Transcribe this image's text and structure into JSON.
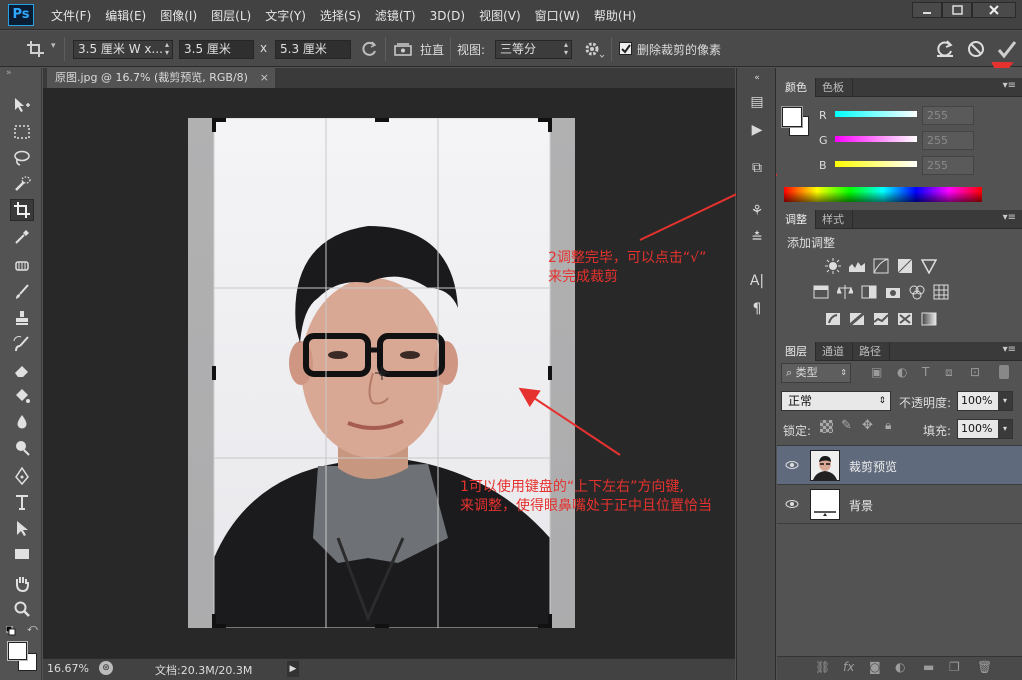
{
  "app": {
    "logo": "Ps"
  },
  "menu": [
    "文件(F)",
    "编辑(E)",
    "图像(I)",
    "图层(L)",
    "文字(Y)",
    "选择(S)",
    "滤镜(T)",
    "3D(D)",
    "视图(V)",
    "窗口(W)",
    "帮助(H)"
  ],
  "options": {
    "ratio_preset": "3.5 厘米 W x...",
    "width": "3.5 厘米",
    "times": "x",
    "height": "5.3 厘米",
    "straighten_label": "拉直",
    "view_label": "视图:",
    "view_value": "三等分",
    "delete_cropped_label": "删除裁剪的像素",
    "delete_cropped_checked": true
  },
  "document": {
    "tab_title": "原图.jpg @ 16.7% (裁剪预览, RGB/8)",
    "close_glyph": "×",
    "zoom": "16.67%",
    "doc_size": "文档:20.3M/20.3M"
  },
  "annotations": {
    "step1_line1": "1可以使用键盘的“上下左右”方向键,",
    "step1_line2": "来调整，使得眼鼻嘴处于正中且位置恰当",
    "step2_line1": "2调整完毕，可以点击“√”",
    "step2_line2": "来完成裁剪"
  },
  "color_panel": {
    "tabs": [
      "颜色",
      "色板"
    ],
    "channels": [
      {
        "label": "R",
        "value": "255",
        "color": "#00ffff"
      },
      {
        "label": "G",
        "value": "255",
        "color": "#ff00ff"
      },
      {
        "label": "B",
        "value": "255",
        "color": "#ffff00"
      }
    ]
  },
  "adjust_panel": {
    "tabs": [
      "调整",
      "样式"
    ],
    "add_label": "添加调整"
  },
  "layers_panel": {
    "tabs": [
      "图层",
      "通道",
      "路径"
    ],
    "filter_label": "类型",
    "blend_mode": "正常",
    "opacity_label": "不透明度:",
    "opacity_value": "100%",
    "lock_label": "锁定:",
    "fill_label": "填充:",
    "fill_value": "100%",
    "layers": [
      {
        "name": "裁剪预览",
        "selected": true
      },
      {
        "name": "背景",
        "selected": false
      }
    ]
  },
  "colors": {
    "annotation": "#e6322e",
    "selection": "#5f6a7c"
  }
}
